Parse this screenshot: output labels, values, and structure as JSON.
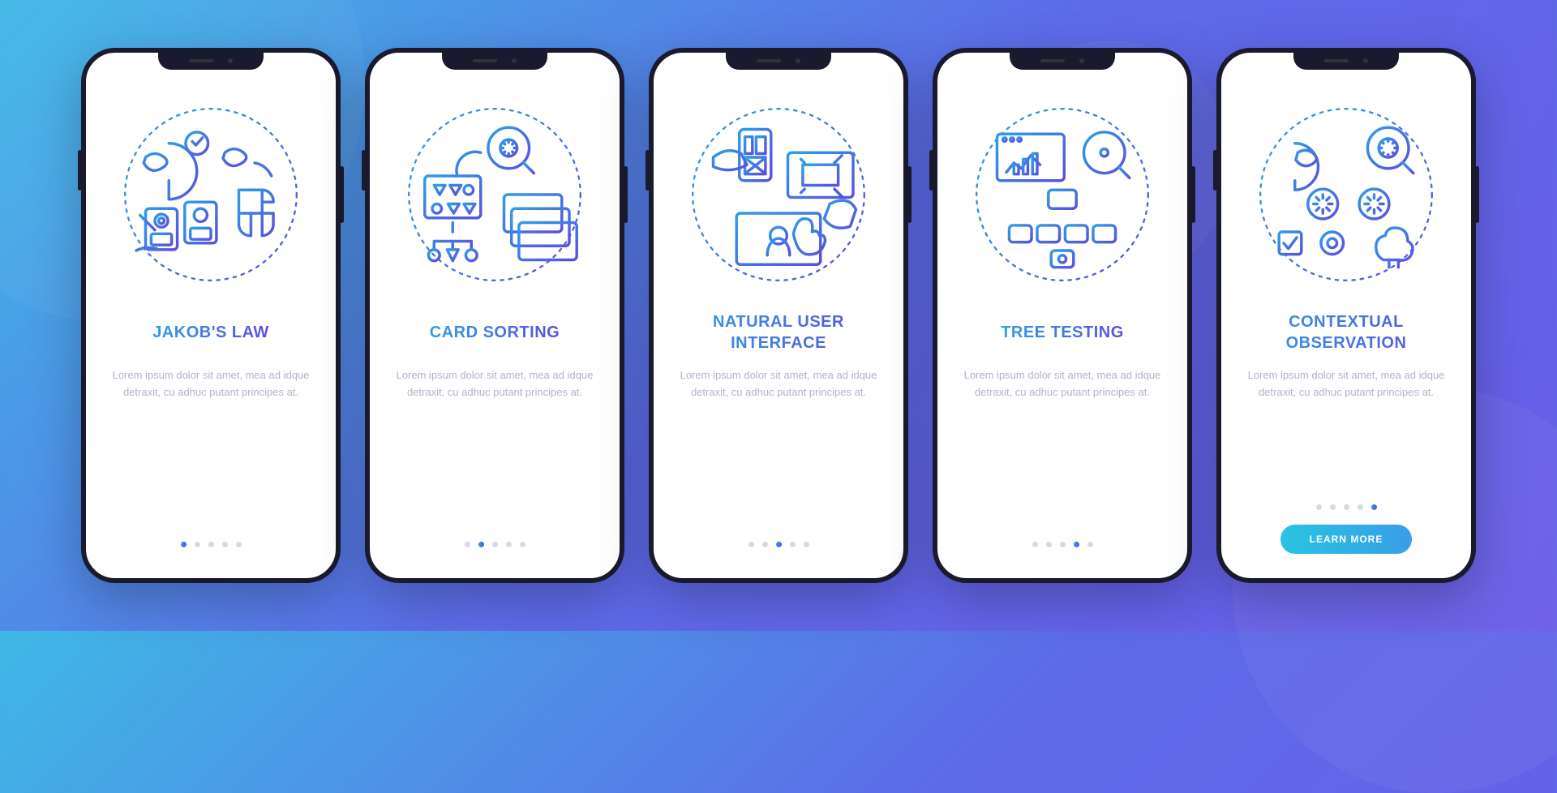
{
  "screens": [
    {
      "title": "JAKOB'S LAW",
      "desc": "Lorem ipsum dolor sit amet, mea ad idque detraxit, cu adhuc putant principes at.",
      "active_index": 0,
      "icon": "jakobs-law-icon"
    },
    {
      "title": "CARD SORTING",
      "desc": "Lorem ipsum dolor sit amet, mea ad idque detraxit, cu adhuc putant principes at.",
      "active_index": 1,
      "icon": "card-sorting-icon"
    },
    {
      "title": "NATURAL USER INTERFACE",
      "desc": "Lorem ipsum dolor sit amet, mea ad idque detraxit, cu adhuc putant principes at.",
      "active_index": 2,
      "icon": "natural-ui-icon"
    },
    {
      "title": "TREE TESTING",
      "desc": "Lorem ipsum dolor sit amet, mea ad idque detraxit, cu adhuc putant principes at.",
      "active_index": 3,
      "icon": "tree-testing-icon"
    },
    {
      "title": "CONTEXTUAL OBSERVATION",
      "desc": "Lorem ipsum dolor sit amet, mea ad idque detraxit, cu adhuc putant principes at.",
      "active_index": 4,
      "icon": "contextual-observation-icon"
    }
  ],
  "dot_count": 5,
  "cta_label": "LEARN MORE"
}
